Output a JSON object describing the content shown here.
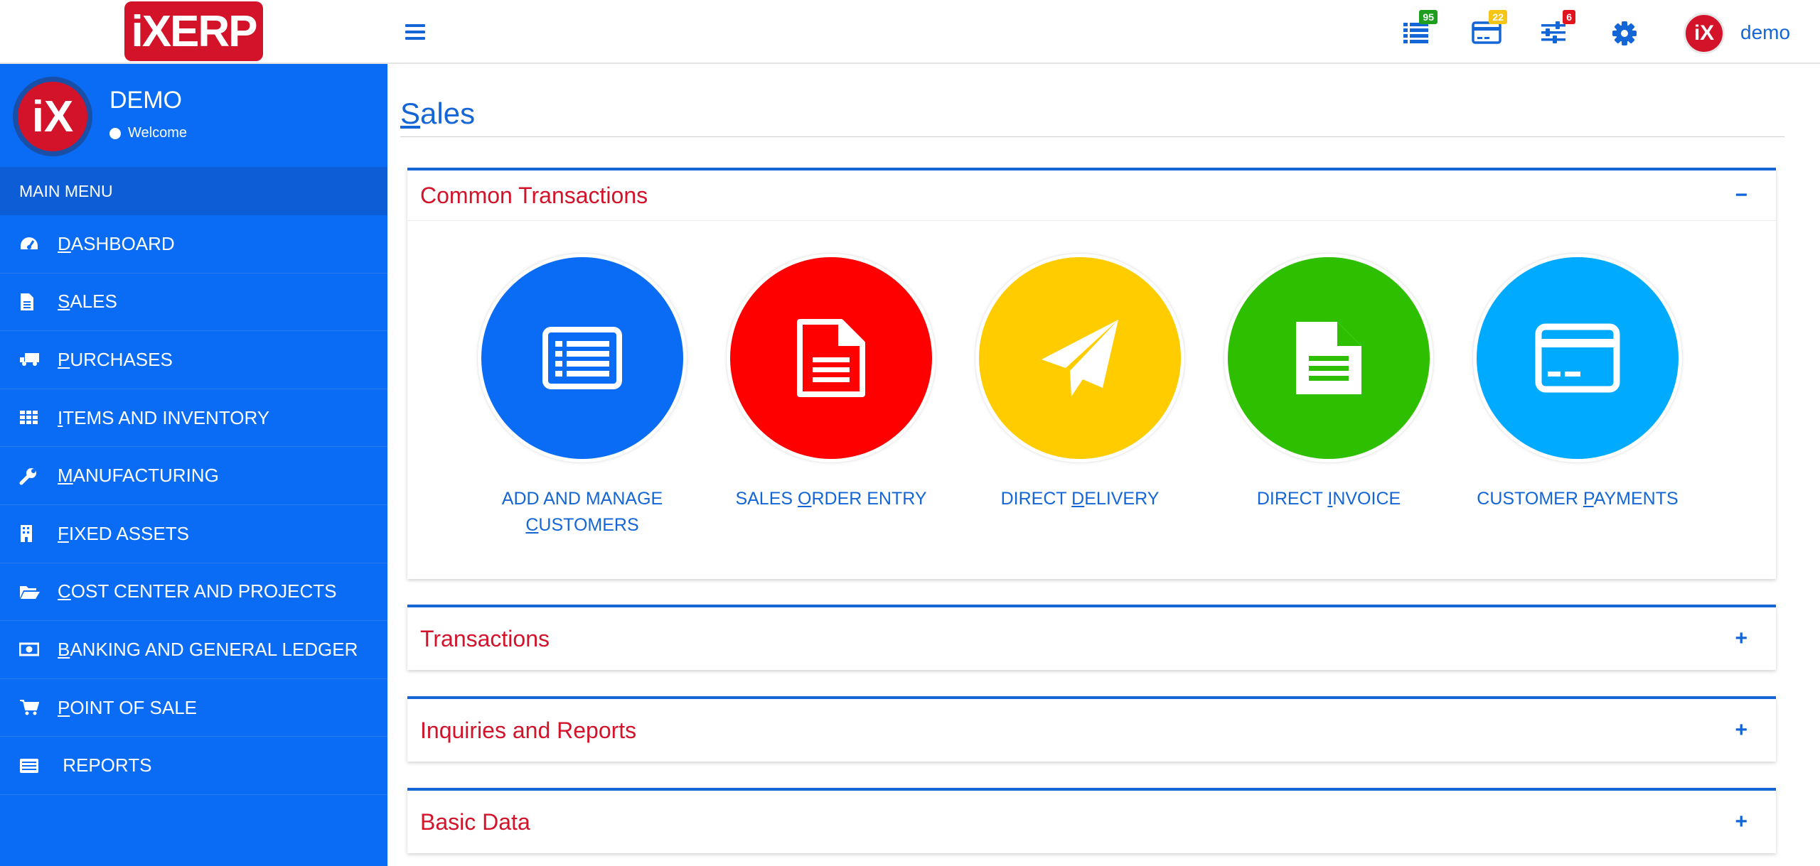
{
  "header": {
    "logo_text": "iXERP",
    "user_name": "demo",
    "badges": {
      "tasks": {
        "count": "95",
        "color": "#1e9e1e"
      },
      "payments": {
        "count": "22",
        "color": "#f5c518"
      },
      "settings": {
        "count": "6",
        "color": "#e0141c"
      }
    }
  },
  "sidebar": {
    "profile": {
      "avatar_text": "iX",
      "name": "DEMO",
      "status": "Welcome"
    },
    "menu_header": "MAIN MENU",
    "items": [
      {
        "pre": "",
        "ul": "D",
        "rest": "ASHBOARD",
        "icon": "tachometer-icon"
      },
      {
        "pre": "",
        "ul": "S",
        "rest": "ALES",
        "icon": "file-icon"
      },
      {
        "pre": "",
        "ul": "P",
        "rest": "URCHASES",
        "icon": "truck-icon"
      },
      {
        "pre": "",
        "ul": "I",
        "rest": "TEMS AND INVENTORY",
        "icon": "grid-icon"
      },
      {
        "pre": "",
        "ul": "M",
        "rest": "ANUFACTURING",
        "icon": "wrench-icon"
      },
      {
        "pre": "",
        "ul": "F",
        "rest": "IXED ASSETS",
        "icon": "building-icon"
      },
      {
        "pre": "",
        "ul": "C",
        "rest": "OST CENTER AND PROJECTS",
        "icon": "folder-open-icon"
      },
      {
        "pre": "",
        "ul": "B",
        "rest": "ANKING AND GENERAL LEDGER",
        "icon": "money-icon"
      },
      {
        "pre": "",
        "ul": "P",
        "rest": "OINT OF SALE",
        "icon": "cart-icon"
      },
      {
        "pre": " REPORTS",
        "ul": "",
        "rest": "",
        "icon": "report-icon"
      }
    ]
  },
  "main": {
    "title_ul": "S",
    "title_rest": "ales",
    "panels": [
      {
        "title": "Common Transactions",
        "toggle": "−",
        "expanded": true
      },
      {
        "title": "Transactions",
        "toggle": "+",
        "expanded": false
      },
      {
        "title": "Inquiries and Reports",
        "toggle": "+",
        "expanded": false
      },
      {
        "title": "Basic Data",
        "toggle": "+",
        "expanded": false
      }
    ],
    "tiles": [
      {
        "line1": "ADD AND MANAGE",
        "line2_ul": "C",
        "line2_rest": "USTOMERS",
        "color": "#0a6cf5",
        "icon": "list-alt-icon"
      },
      {
        "pre": "SALES ",
        "ul": "O",
        "rest": "RDER ENTRY",
        "color": "#ff0000",
        "icon": "document-icon"
      },
      {
        "pre": "DIRECT ",
        "ul": "D",
        "rest": "ELIVERY",
        "color": "#ffcc00",
        "icon": "paper-plane-icon"
      },
      {
        "pre": "DIRECT ",
        "ul": "I",
        "rest": "NVOICE",
        "color": "#2ec000",
        "icon": "invoice-icon"
      },
      {
        "pre": "CUSTOMER ",
        "ul": "P",
        "rest": "AYMENTS",
        "color": "#00aaff",
        "icon": "credit-card-icon"
      }
    ]
  }
}
